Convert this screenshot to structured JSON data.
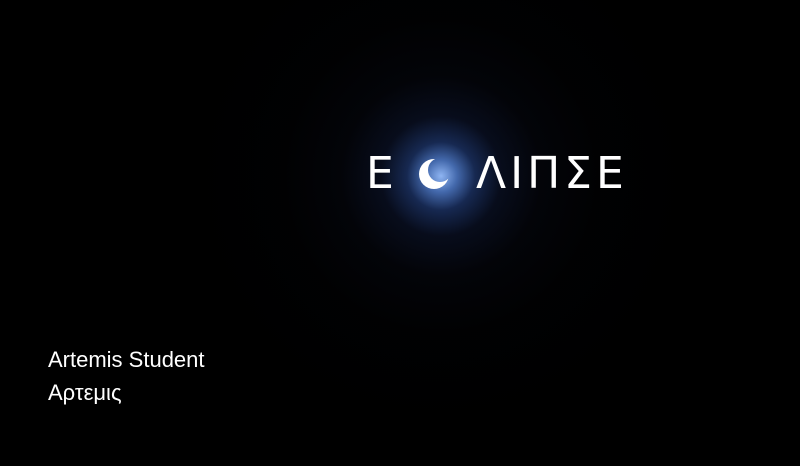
{
  "slide": {
    "title_first": "E",
    "title_icon": "crescent-moon-icon",
    "title_rest": "ΛΙΠΣΕ",
    "author_name": "Artemis Student",
    "author_greek": "Αρτεμις"
  },
  "colors": {
    "background": "#000000",
    "halo": "#7aa6ff",
    "text": "#ffffff"
  }
}
